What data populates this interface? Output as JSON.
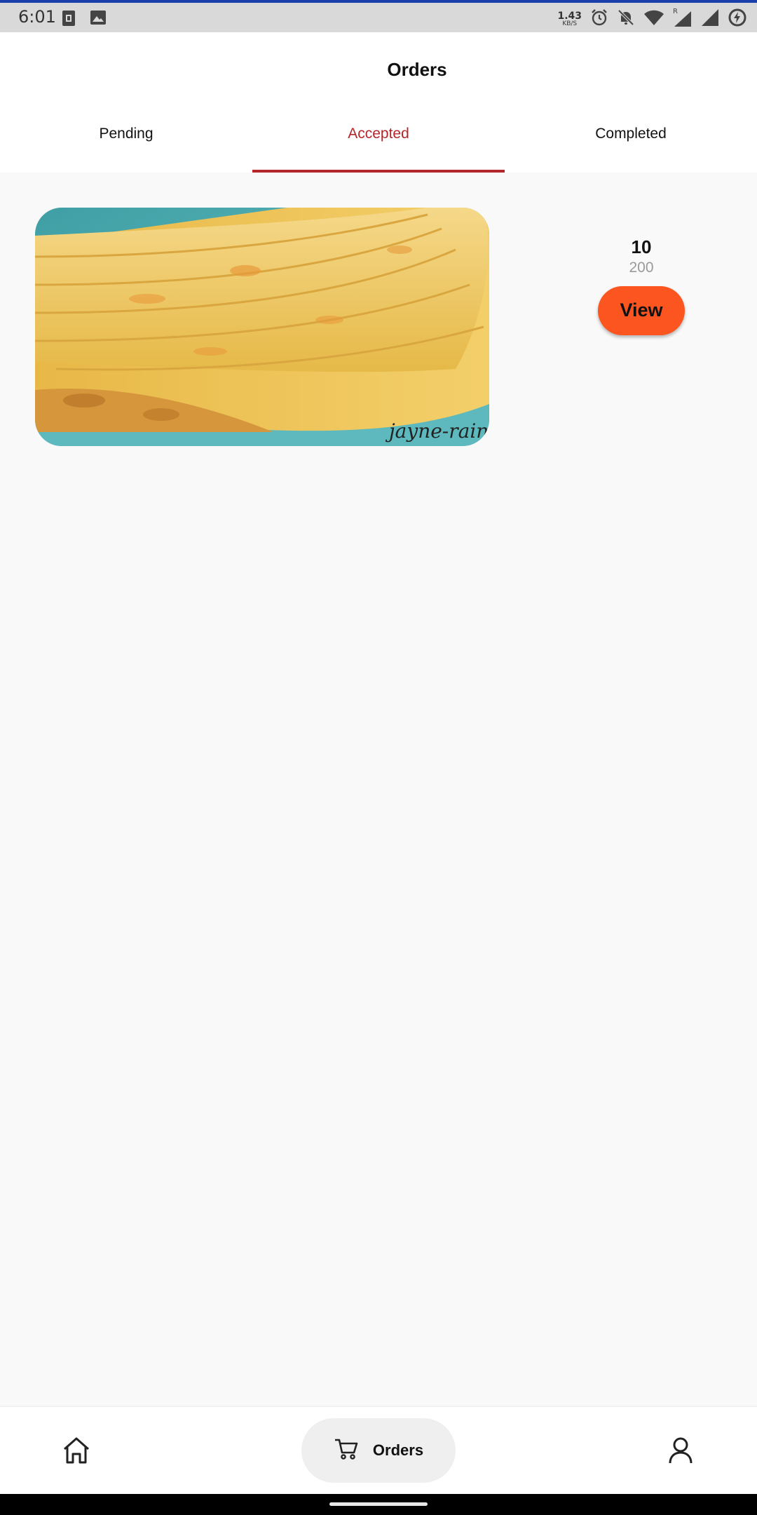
{
  "status_bar": {
    "time": "6:01",
    "net_speed_value": "1.43",
    "net_speed_unit": "KB/S",
    "icons": [
      "sim-card-icon",
      "image-icon",
      "alarm-icon",
      "notifications-off-icon",
      "wifi-icon",
      "signal-roaming-icon",
      "signal-icon",
      "battery-saver-icon"
    ]
  },
  "header": {
    "title": "Orders"
  },
  "tabs": [
    {
      "label": "Pending",
      "active": false
    },
    {
      "label": "Accepted",
      "active": true
    },
    {
      "label": "Completed",
      "active": false
    }
  ],
  "orders": [
    {
      "image_watermark": "jayne-rain.c",
      "quantity": "10",
      "price": "200",
      "view_label": "View"
    }
  ],
  "bottom_nav": {
    "home_icon": "home-icon",
    "orders_icon": "cart-icon",
    "orders_label": "Orders",
    "profile_icon": "person-icon"
  },
  "colors": {
    "accent": "#b3262a",
    "view_button": "#fc5520",
    "background": "#f9f9f9"
  }
}
